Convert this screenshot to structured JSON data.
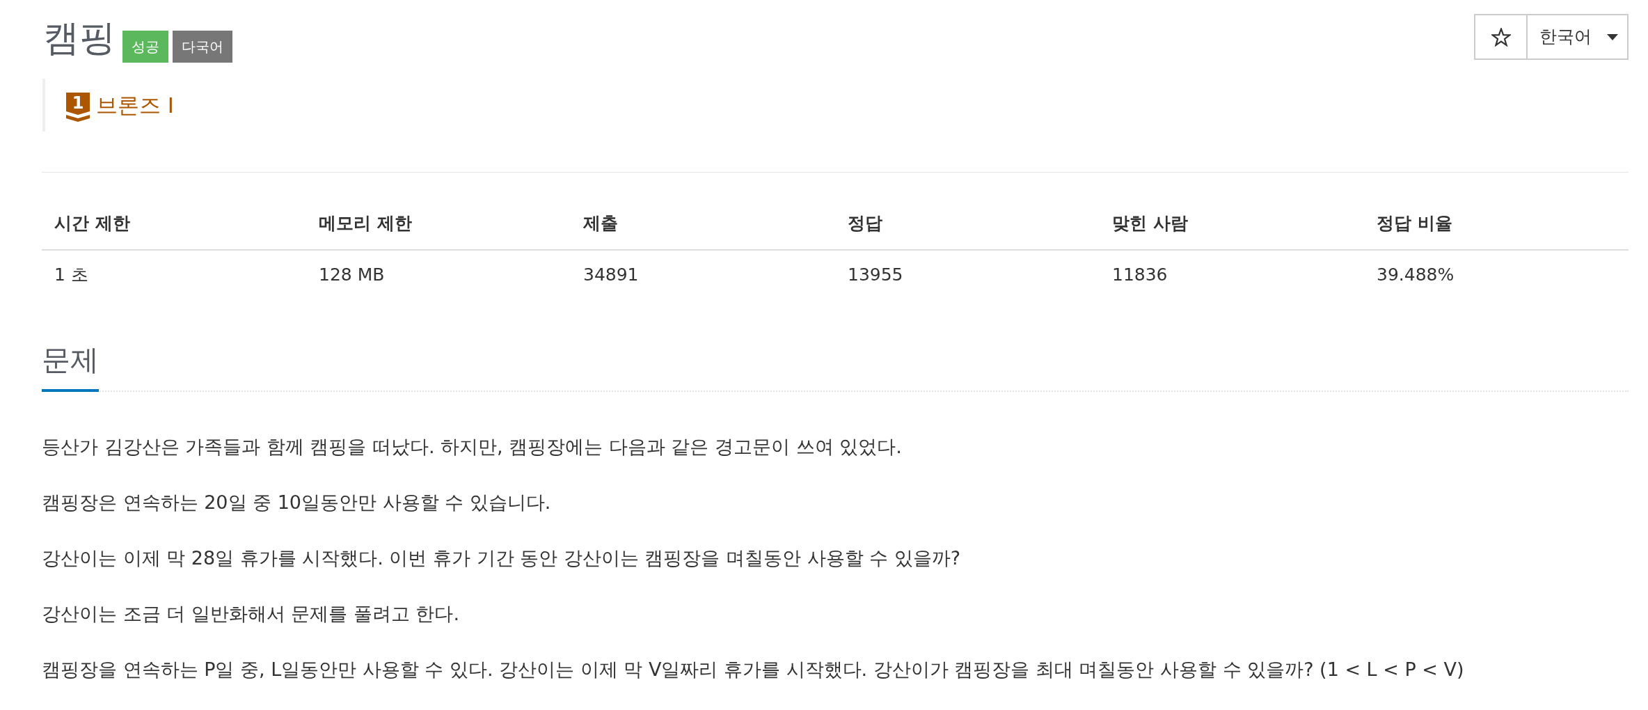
{
  "header": {
    "title": "캠핑",
    "badges": [
      {
        "text": "성공",
        "kind": "success"
      },
      {
        "text": "다국어",
        "kind": "multilang"
      }
    ]
  },
  "toolbar": {
    "starred": false,
    "language": "한국어"
  },
  "tier": {
    "number": "1",
    "name": "브론즈 I"
  },
  "stats": {
    "columns": [
      "시간 제한",
      "메모리 제한",
      "제출",
      "정답",
      "맞힌 사람",
      "정답 비율"
    ],
    "rows": [
      [
        "1 초",
        "128 MB",
        "34891",
        "13955",
        "11836",
        "39.488%"
      ]
    ]
  },
  "problem": {
    "heading": "문제",
    "paragraphs": [
      "등산가 김강산은 가족들과 함께 캠핑을 떠났다. 하지만, 캠핑장에는 다음과 같은 경고문이 쓰여 있었다.",
      "캠핑장은 연속하는 20일 중 10일동안만 사용할 수 있습니다.",
      "강산이는 이제 막 28일 휴가를 시작했다. 이번 휴가 기간 동안 강산이는 캠핑장을 며칠동안 사용할 수 있을까?",
      "강산이는 조금 더 일반화해서 문제를 풀려고 한다.",
      "캠핑장을 연속하는 P일 중, L일동안만 사용할 수 있다. 강산이는 이제 막 V일짜리 휴가를 시작했다. 강산이가 캠핑장을 최대 며칠동안 사용할 수 있을까? (1 < L < P < V)"
    ]
  }
}
